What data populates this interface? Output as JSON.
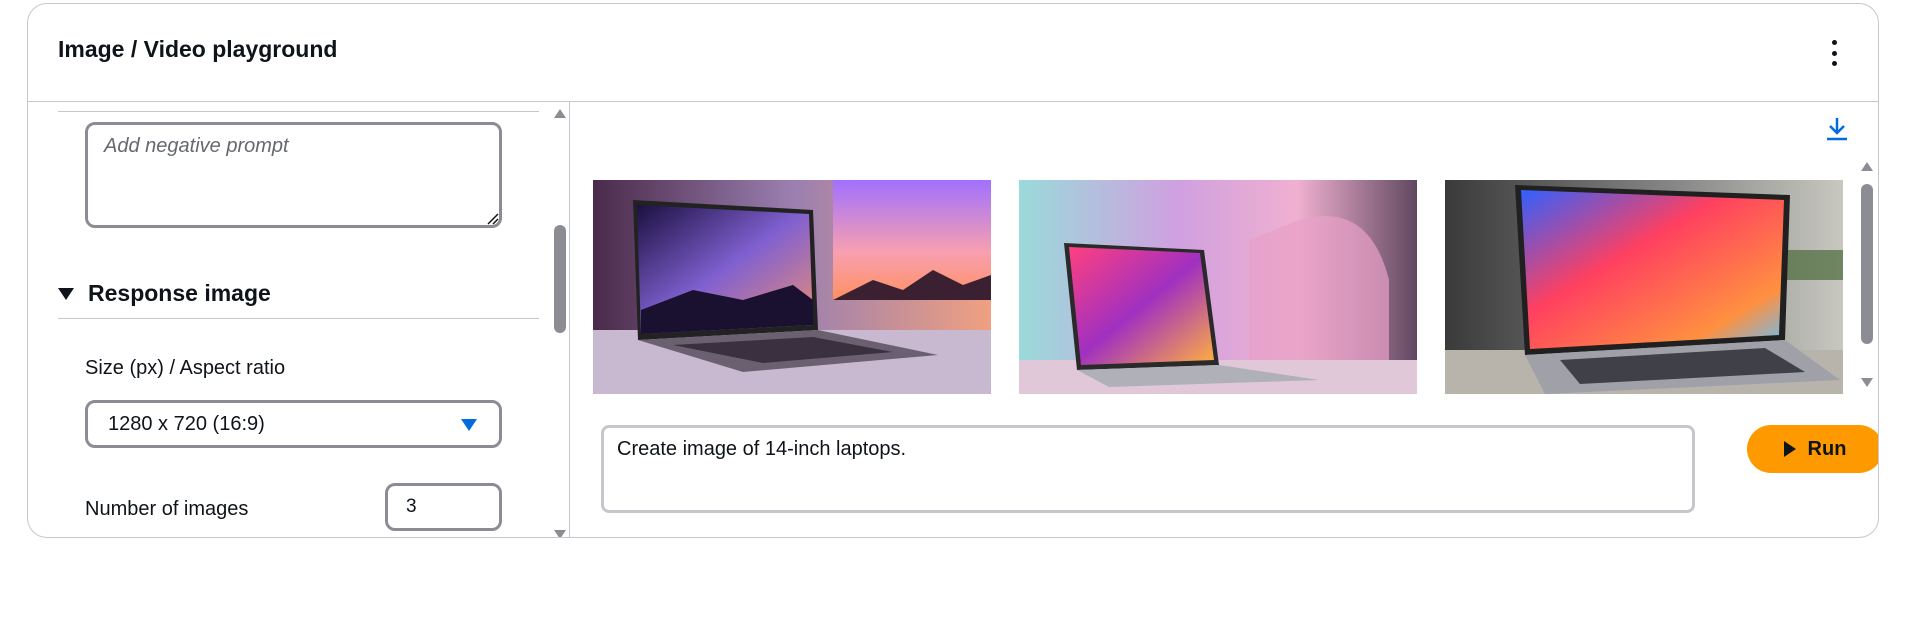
{
  "header": {
    "title": "Image / Video playground",
    "menu_icon": "more-vertical-icon"
  },
  "settings": {
    "negative_prompt": {
      "value": "",
      "placeholder": "Add negative prompt"
    },
    "response_image_section": {
      "label": "Response image",
      "expanded": true
    },
    "size": {
      "label": "Size (px) / Aspect ratio",
      "selected": "1280 x 720 (16:9)"
    },
    "num_images": {
      "label": "Number of images",
      "value": "3"
    }
  },
  "output": {
    "download_icon": "download-icon",
    "images": [
      {
        "name": "laptop-purple-mountain-wallpaper"
      },
      {
        "name": "laptop-pink-abstract-wallpaper"
      },
      {
        "name": "laptop-colorful-wave-wallpaper"
      }
    ]
  },
  "prompt": {
    "value": "Create image of 14-inch laptops.",
    "run_label": "Run",
    "run_icon": "play-icon"
  },
  "colors": {
    "accent_orange": "#ff9900",
    "link_blue": "#006ce0",
    "border_gray": "#8c8c94",
    "divider_gray": "#c6c6cd",
    "text_dark": "#0f141a"
  }
}
